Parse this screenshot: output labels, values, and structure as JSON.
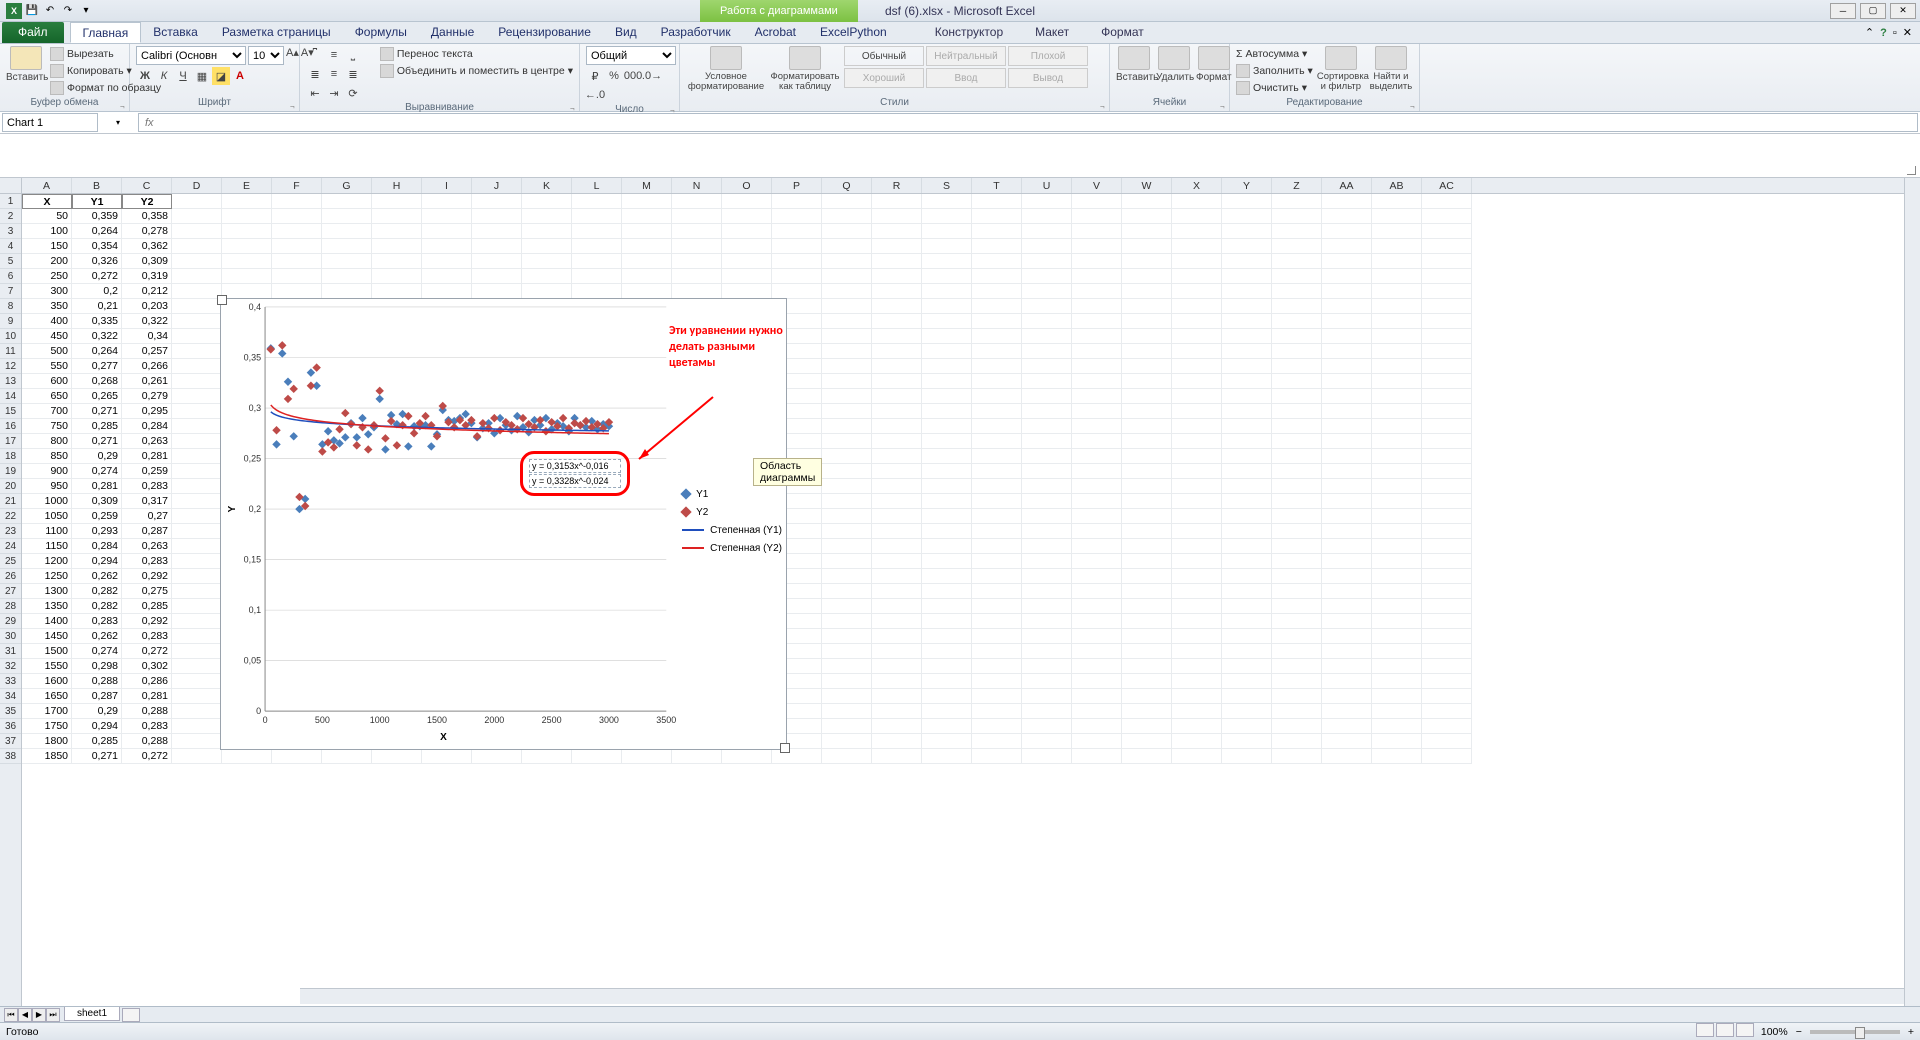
{
  "title": "dsf (6).xlsx - Microsoft Excel",
  "chart_tools_title": "Работа с диаграммами",
  "tabs": {
    "file": "Файл",
    "items": [
      "Главная",
      "Вставка",
      "Разметка страницы",
      "Формулы",
      "Данные",
      "Рецензирование",
      "Вид",
      "Разработчик",
      "Acrobat",
      "ExcelPython"
    ],
    "context": [
      "Конструктор",
      "Макет",
      "Формат"
    ],
    "active": "Главная"
  },
  "ribbon": {
    "clipboard": {
      "label": "Буфер обмена",
      "paste": "Вставить",
      "cut": "Вырезать",
      "copy": "Копировать",
      "painter": "Формат по образцу"
    },
    "font": {
      "label": "Шрифт",
      "name": "Calibri (Основн",
      "size": "10"
    },
    "align": {
      "label": "Выравнивание",
      "wrap": "Перенос текста",
      "merge": "Объединить и поместить в центре"
    },
    "number": {
      "label": "Число",
      "format": "Общий"
    },
    "styles": {
      "label": "Стили",
      "cond": "Условное форматирование",
      "table": "Форматировать как таблицу",
      "cells": [
        "Обычный",
        "Нейтральный",
        "Плохой",
        "Хороший",
        "Ввод",
        "Вывод"
      ]
    },
    "cells2": {
      "label": "Ячейки",
      "insert": "Вставить",
      "delete": "Удалить",
      "format": "Формат"
    },
    "editing": {
      "label": "Редактирование",
      "sum": "Автосумма",
      "fill": "Заполнить",
      "clear": "Очистить",
      "sort": "Сортировка и фильтр",
      "find": "Найти и выделить"
    }
  },
  "namebox": "Chart 1",
  "fx": "",
  "columns": [
    "A",
    "B",
    "C",
    "D",
    "E",
    "F",
    "G",
    "H",
    "I",
    "J",
    "K",
    "L",
    "M",
    "N",
    "O",
    "P",
    "Q",
    "R",
    "S",
    "T",
    "U",
    "V",
    "W",
    "X",
    "Y",
    "Z",
    "AA",
    "AB",
    "AC"
  ],
  "headers": [
    "X",
    "Y1",
    "Y2"
  ],
  "rows": [
    [
      50,
      "0,359",
      "0,358"
    ],
    [
      100,
      "0,264",
      "0,278"
    ],
    [
      150,
      "0,354",
      "0,362"
    ],
    [
      200,
      "0,326",
      "0,309"
    ],
    [
      250,
      "0,272",
      "0,319"
    ],
    [
      300,
      "0,2",
      "0,212"
    ],
    [
      350,
      "0,21",
      "0,203"
    ],
    [
      400,
      "0,335",
      "0,322"
    ],
    [
      450,
      "0,322",
      "0,34"
    ],
    [
      500,
      "0,264",
      "0,257"
    ],
    [
      550,
      "0,277",
      "0,266"
    ],
    [
      600,
      "0,268",
      "0,261"
    ],
    [
      650,
      "0,265",
      "0,279"
    ],
    [
      700,
      "0,271",
      "0,295"
    ],
    [
      750,
      "0,285",
      "0,284"
    ],
    [
      800,
      "0,271",
      "0,263"
    ],
    [
      850,
      "0,29",
      "0,281"
    ],
    [
      900,
      "0,274",
      "0,259"
    ],
    [
      950,
      "0,281",
      "0,283"
    ],
    [
      1000,
      "0,309",
      "0,317"
    ],
    [
      1050,
      "0,259",
      "0,27"
    ],
    [
      1100,
      "0,293",
      "0,287"
    ],
    [
      1150,
      "0,284",
      "0,263"
    ],
    [
      1200,
      "0,294",
      "0,283"
    ],
    [
      1250,
      "0,262",
      "0,292"
    ],
    [
      1300,
      "0,282",
      "0,275"
    ],
    [
      1350,
      "0,282",
      "0,285"
    ],
    [
      1400,
      "0,283",
      "0,292"
    ],
    [
      1450,
      "0,262",
      "0,283"
    ],
    [
      1500,
      "0,274",
      "0,272"
    ],
    [
      1550,
      "0,298",
      "0,302"
    ],
    [
      1600,
      "0,288",
      "0,286"
    ],
    [
      1650,
      "0,287",
      "0,281"
    ],
    [
      1700,
      "0,29",
      "0,288"
    ],
    [
      1750,
      "0,294",
      "0,283"
    ],
    [
      1800,
      "0,285",
      "0,288"
    ],
    [
      1850,
      "0,271",
      "0,272"
    ]
  ],
  "chart_data": {
    "type": "scatter",
    "x_title": "X",
    "y_title": "Y",
    "xlim": [
      0,
      3500
    ],
    "ylim": [
      0,
      0.4
    ],
    "xticks": [
      0,
      500,
      1000,
      1500,
      2000,
      2500,
      3000,
      3500
    ],
    "yticks": [
      0,
      0.05,
      0.1,
      0.15,
      0.2,
      0.25,
      0.3,
      0.35,
      0.4
    ],
    "series": [
      {
        "name": "Y1",
        "color": "#4a7ebb",
        "points": [
          [
            50,
            0.359
          ],
          [
            100,
            0.264
          ],
          [
            150,
            0.354
          ],
          [
            200,
            0.326
          ],
          [
            250,
            0.272
          ],
          [
            300,
            0.2
          ],
          [
            350,
            0.21
          ],
          [
            400,
            0.335
          ],
          [
            450,
            0.322
          ],
          [
            500,
            0.264
          ],
          [
            550,
            0.277
          ],
          [
            600,
            0.268
          ],
          [
            650,
            0.265
          ],
          [
            700,
            0.271
          ],
          [
            750,
            0.285
          ],
          [
            800,
            0.271
          ],
          [
            850,
            0.29
          ],
          [
            900,
            0.274
          ],
          [
            950,
            0.281
          ],
          [
            1000,
            0.309
          ],
          [
            1050,
            0.259
          ],
          [
            1100,
            0.293
          ],
          [
            1150,
            0.284
          ],
          [
            1200,
            0.294
          ],
          [
            1250,
            0.262
          ],
          [
            1300,
            0.282
          ],
          [
            1350,
            0.282
          ],
          [
            1400,
            0.283
          ],
          [
            1450,
            0.262
          ],
          [
            1500,
            0.274
          ],
          [
            1550,
            0.298
          ],
          [
            1600,
            0.288
          ],
          [
            1650,
            0.287
          ],
          [
            1700,
            0.29
          ],
          [
            1750,
            0.294
          ],
          [
            1800,
            0.285
          ],
          [
            1850,
            0.271
          ],
          [
            1900,
            0.28
          ],
          [
            1950,
            0.285
          ],
          [
            2000,
            0.275
          ],
          [
            2050,
            0.29
          ],
          [
            2100,
            0.283
          ],
          [
            2150,
            0.278
          ],
          [
            2200,
            0.292
          ],
          [
            2250,
            0.281
          ],
          [
            2300,
            0.276
          ],
          [
            2350,
            0.288
          ],
          [
            2400,
            0.283
          ],
          [
            2450,
            0.29
          ],
          [
            2500,
            0.279
          ],
          [
            2550,
            0.285
          ],
          [
            2600,
            0.282
          ],
          [
            2650,
            0.277
          ],
          [
            2700,
            0.29
          ],
          [
            2750,
            0.283
          ],
          [
            2800,
            0.281
          ],
          [
            2850,
            0.287
          ],
          [
            2900,
            0.279
          ],
          [
            2950,
            0.284
          ],
          [
            3000,
            0.282
          ]
        ]
      },
      {
        "name": "Y2",
        "color": "#be4b48",
        "points": [
          [
            50,
            0.358
          ],
          [
            100,
            0.278
          ],
          [
            150,
            0.362
          ],
          [
            200,
            0.309
          ],
          [
            250,
            0.319
          ],
          [
            300,
            0.212
          ],
          [
            350,
            0.203
          ],
          [
            400,
            0.322
          ],
          [
            450,
            0.34
          ],
          [
            500,
            0.257
          ],
          [
            550,
            0.266
          ],
          [
            600,
            0.261
          ],
          [
            650,
            0.279
          ],
          [
            700,
            0.295
          ],
          [
            750,
            0.284
          ],
          [
            800,
            0.263
          ],
          [
            850,
            0.281
          ],
          [
            900,
            0.259
          ],
          [
            950,
            0.283
          ],
          [
            1000,
            0.317
          ],
          [
            1050,
            0.27
          ],
          [
            1100,
            0.287
          ],
          [
            1150,
            0.263
          ],
          [
            1200,
            0.283
          ],
          [
            1250,
            0.292
          ],
          [
            1300,
            0.275
          ],
          [
            1350,
            0.285
          ],
          [
            1400,
            0.292
          ],
          [
            1450,
            0.283
          ],
          [
            1500,
            0.272
          ],
          [
            1550,
            0.302
          ],
          [
            1600,
            0.286
          ],
          [
            1650,
            0.281
          ],
          [
            1700,
            0.288
          ],
          [
            1750,
            0.283
          ],
          [
            1800,
            0.288
          ],
          [
            1850,
            0.272
          ],
          [
            1900,
            0.285
          ],
          [
            1950,
            0.28
          ],
          [
            2000,
            0.29
          ],
          [
            2050,
            0.278
          ],
          [
            2100,
            0.286
          ],
          [
            2150,
            0.283
          ],
          [
            2200,
            0.279
          ],
          [
            2250,
            0.29
          ],
          [
            2300,
            0.284
          ],
          [
            2350,
            0.281
          ],
          [
            2400,
            0.288
          ],
          [
            2450,
            0.277
          ],
          [
            2500,
            0.286
          ],
          [
            2550,
            0.282
          ],
          [
            2600,
            0.29
          ],
          [
            2650,
            0.28
          ],
          [
            2700,
            0.285
          ],
          [
            2750,
            0.283
          ],
          [
            2800,
            0.287
          ],
          [
            2850,
            0.281
          ],
          [
            2900,
            0.284
          ],
          [
            2950,
            0.28
          ],
          [
            3000,
            0.286
          ]
        ]
      }
    ],
    "trendlines": [
      {
        "name": "Степенная (Y1)",
        "equation": "y = 0,3153x^-0,016",
        "a": 0.3153,
        "b": -0.016,
        "color": "#1f4ebd"
      },
      {
        "name": "Степенная (Y2)",
        "equation": "y = 0,3328x^-0,024",
        "a": 0.3328,
        "b": -0.024,
        "color": "#d22"
      }
    ],
    "annotation": "Эти уравнении нужно делать разными цветамы"
  },
  "tooltip": "Область диаграммы",
  "sheet_tab": "sheet1",
  "status": "Готово",
  "zoom": "100%"
}
